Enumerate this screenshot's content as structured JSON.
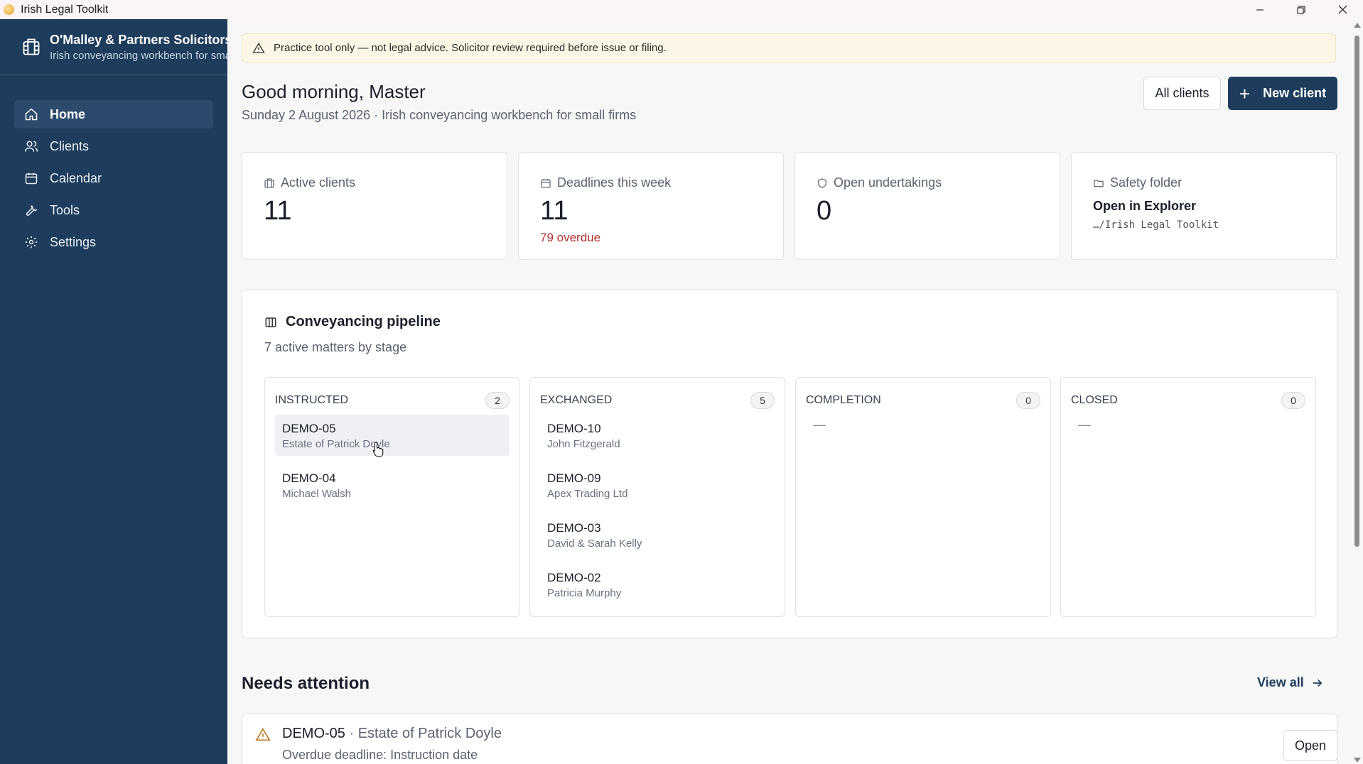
{
  "window": {
    "title": "Irish Legal Toolkit",
    "minimize_glyph": "—",
    "maximize_glyph": "❐",
    "close_glyph": "✕"
  },
  "sidebar": {
    "firm_name": "O'Malley & Partners Solicitors",
    "firm_tagline": "Irish conveyancing workbench for small firms",
    "items": [
      {
        "label": "Home",
        "icon": "home-icon",
        "active": true
      },
      {
        "label": "Clients",
        "icon": "users-icon",
        "active": false
      },
      {
        "label": "Calendar",
        "icon": "calendar-icon",
        "active": false
      },
      {
        "label": "Tools",
        "icon": "wrench-icon",
        "active": false
      },
      {
        "label": "Settings",
        "icon": "gear-icon",
        "active": false
      }
    ]
  },
  "banner": {
    "text": "Practice tool only — not legal advice. Solicitor review required before issue or filing.",
    "icon": "warning-icon"
  },
  "header": {
    "greeting": "Good morning, Master",
    "subtitle": "Sunday 2 August 2026 · Irish conveyancing workbench for small firms",
    "all_clients_label": "All clients",
    "new_client_label": "New client"
  },
  "stats": {
    "active_clients": {
      "label": "Active clients",
      "value": "11",
      "icon": "building-icon"
    },
    "deadlines": {
      "label": "Deadlines this week",
      "value": "11",
      "note": "79 overdue",
      "icon": "calendar-icon"
    },
    "undertakings": {
      "label": "Open undertakings",
      "value": "0",
      "icon": "shield-icon"
    },
    "safety": {
      "label": "Safety folder",
      "link": "Open in Explorer",
      "path": "…/Irish Legal Toolkit",
      "icon": "folder-icon"
    }
  },
  "pipeline": {
    "title": "Conveyancing pipeline",
    "subtitle": "7 active matters by stage",
    "columns": [
      {
        "name": "INSTRUCTED",
        "count": "2",
        "matters": [
          {
            "id": "DEMO-05",
            "client": "Estate of Patrick Doyle"
          },
          {
            "id": "DEMO-04",
            "client": "Michael Walsh"
          }
        ]
      },
      {
        "name": "EXCHANGED",
        "count": "5",
        "matters": [
          {
            "id": "DEMO-10",
            "client": "John Fitzgerald"
          },
          {
            "id": "DEMO-09",
            "client": "Apex Trading Ltd"
          },
          {
            "id": "DEMO-03",
            "client": "David & Sarah Kelly"
          },
          {
            "id": "DEMO-02",
            "client": "Patricia Murphy"
          }
        ]
      },
      {
        "name": "COMPLETION",
        "count": "0",
        "empty": "—"
      },
      {
        "name": "CLOSED",
        "count": "0",
        "empty": "—"
      }
    ]
  },
  "attention": {
    "title": "Needs attention",
    "view_all": "View all",
    "item": {
      "matter_id": "DEMO-05",
      "separator": " · ",
      "client": "Estate of Patrick Doyle",
      "detail": "Overdue deadline: Instruction date",
      "open_label": "Open"
    }
  },
  "colors": {
    "sidebar": "#1e3d5c",
    "primary": "#1e3d5c",
    "warning_text": "#b03030",
    "banner_bg": "#fbf6e6"
  }
}
